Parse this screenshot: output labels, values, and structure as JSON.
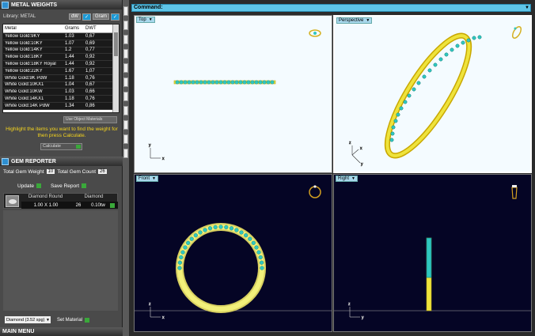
{
  "metal_weights": {
    "title": "METAL WEIGHTS",
    "library_label": "Library: METAL",
    "btn_dwt": "dW",
    "btn_grams": "Gram",
    "columns": [
      "Metal",
      "Grams",
      "DWT"
    ],
    "rows": [
      [
        "Yellow Gold:9KY",
        "1.03",
        "0,67"
      ],
      [
        "Yellow Gold:10KY",
        "1.07",
        "0,69"
      ],
      [
        "Yellow Gold:14KY",
        "1.2",
        "0,77"
      ],
      [
        "Yellow Gold:18KY",
        "1.44",
        "0,92"
      ],
      [
        "Yellow Gold:18KY Royal",
        "1.44",
        "0,92"
      ],
      [
        "Yellow Gold:22KY",
        "1.67",
        "1,07"
      ],
      [
        "White Gold:9K PdW",
        "1.18",
        "0,76"
      ],
      [
        "White Gold:10KX1",
        "1.04",
        "0,67"
      ],
      [
        "White Gold:10KW",
        "1.03",
        "0,66"
      ],
      [
        "White Gold:14KX1",
        "1.18",
        "0,76"
      ],
      [
        "White Gold:14K PdW",
        "1.34",
        "0,86"
      ]
    ],
    "use_object_materials": "Use Object Materials",
    "hint": "Highlight the items you want to find the weight for then press Calculate.",
    "calculate_label": "Calculate"
  },
  "gem_reporter": {
    "title": "GEM REPORTER",
    "total_weight_label": "Total Gem Weight",
    "total_weight_value": "10",
    "total_count_label": "Total Gem Count",
    "total_count_value": "26",
    "update_label": "Update",
    "save_report_label": "Save Report",
    "table_headers": [
      "Diamond Round",
      "Diamond"
    ],
    "row": {
      "size": "1.00 X 1.00",
      "count": "26",
      "weight": "0.10tw"
    }
  },
  "material": {
    "select_value": "Diamond",
    "select_sg": "(3.52 spg)",
    "set_material_label": "Set Material"
  },
  "main_menu": "MAIN MENU",
  "command_label": "Command:",
  "viewports": {
    "top": "Top",
    "perspective": "Perspective",
    "front": "Front",
    "right": "Right"
  },
  "colors": {
    "gold": "#e8e33a",
    "gem": "#2fc7c0",
    "accent": "#5ec5e8",
    "hint": "#f7d61d"
  }
}
